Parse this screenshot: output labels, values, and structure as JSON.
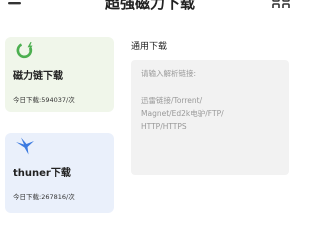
{
  "header": {
    "title": "超强磁力下载",
    "left_icon": "menu-icon",
    "right_icon": "grid-icon"
  },
  "cards": [
    {
      "icon": "magnet-icon",
      "title": "磁力链下载",
      "stat": "今日下载:594037/次",
      "color": "#4caf50",
      "background": "#f0f6ea"
    },
    {
      "icon": "thunder-bird-icon",
      "title": "thuner下载",
      "stat": "今日下载:267816/次",
      "color": "#3d7be0",
      "background": "#eaf0fb"
    }
  ],
  "general": {
    "label": "通用下载",
    "input_placeholder": "请输入解析链接:",
    "hint_lines": [
      "迅雷链接/Torrent/",
      "Magnet/Ed2k电驴/FTP/",
      "HTTP/HTTPS"
    ]
  }
}
